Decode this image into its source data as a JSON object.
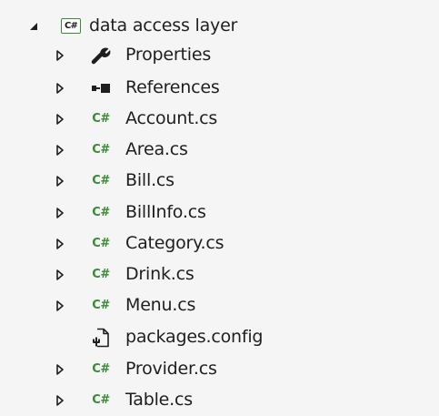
{
  "explorer": {
    "project": {
      "label": "data access layer",
      "icon": "csharp-project-icon",
      "expanded": true
    },
    "items": [
      {
        "label": "Properties",
        "icon": "wrench-icon",
        "expandable": true
      },
      {
        "label": "References",
        "icon": "references-icon",
        "expandable": true
      },
      {
        "label": "Account.cs",
        "icon": "csharp-file-icon",
        "expandable": true
      },
      {
        "label": "Area.cs",
        "icon": "csharp-file-icon",
        "expandable": true
      },
      {
        "label": "Bill.cs",
        "icon": "csharp-file-icon",
        "expandable": true
      },
      {
        "label": "BillInfo.cs",
        "icon": "csharp-file-icon",
        "expandable": true
      },
      {
        "label": "Category.cs",
        "icon": "csharp-file-icon",
        "expandable": true
      },
      {
        "label": "Drink.cs",
        "icon": "csharp-file-icon",
        "expandable": true
      },
      {
        "label": "Menu.cs",
        "icon": "csharp-file-icon",
        "expandable": true
      },
      {
        "label": "packages.config",
        "icon": "config-file-icon",
        "expandable": false
      },
      {
        "label": "Provider.cs",
        "icon": "csharp-file-icon",
        "expandable": true
      },
      {
        "label": "Table.cs",
        "icon": "csharp-file-icon",
        "expandable": true
      }
    ],
    "icon_glyphs": {
      "csharp": "C#"
    },
    "colors": {
      "csharp_green": "#388a34",
      "background": "#f5f5f5",
      "text": "#1e1e1e"
    }
  }
}
